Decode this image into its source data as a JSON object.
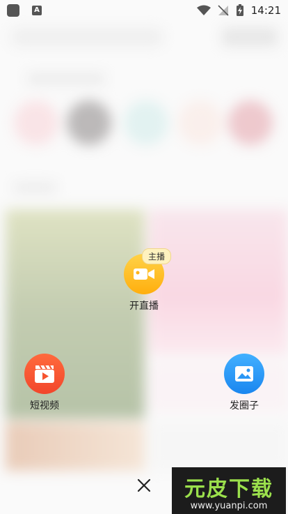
{
  "status_bar": {
    "time": "14:21"
  },
  "actions": {
    "live": {
      "label": "开直播",
      "badge": "主播",
      "icon": "video-camera-icon",
      "color": "#ffc21a"
    },
    "short_video": {
      "label": "短视频",
      "icon": "clapperboard-icon",
      "color": "#f6532f"
    },
    "post": {
      "label": "发圈子",
      "icon": "image-icon",
      "color": "#2a97f5"
    }
  },
  "close": {
    "icon": "close-icon"
  },
  "watermark": {
    "title": "元皮下载",
    "url": "www.yuanpi.com"
  }
}
